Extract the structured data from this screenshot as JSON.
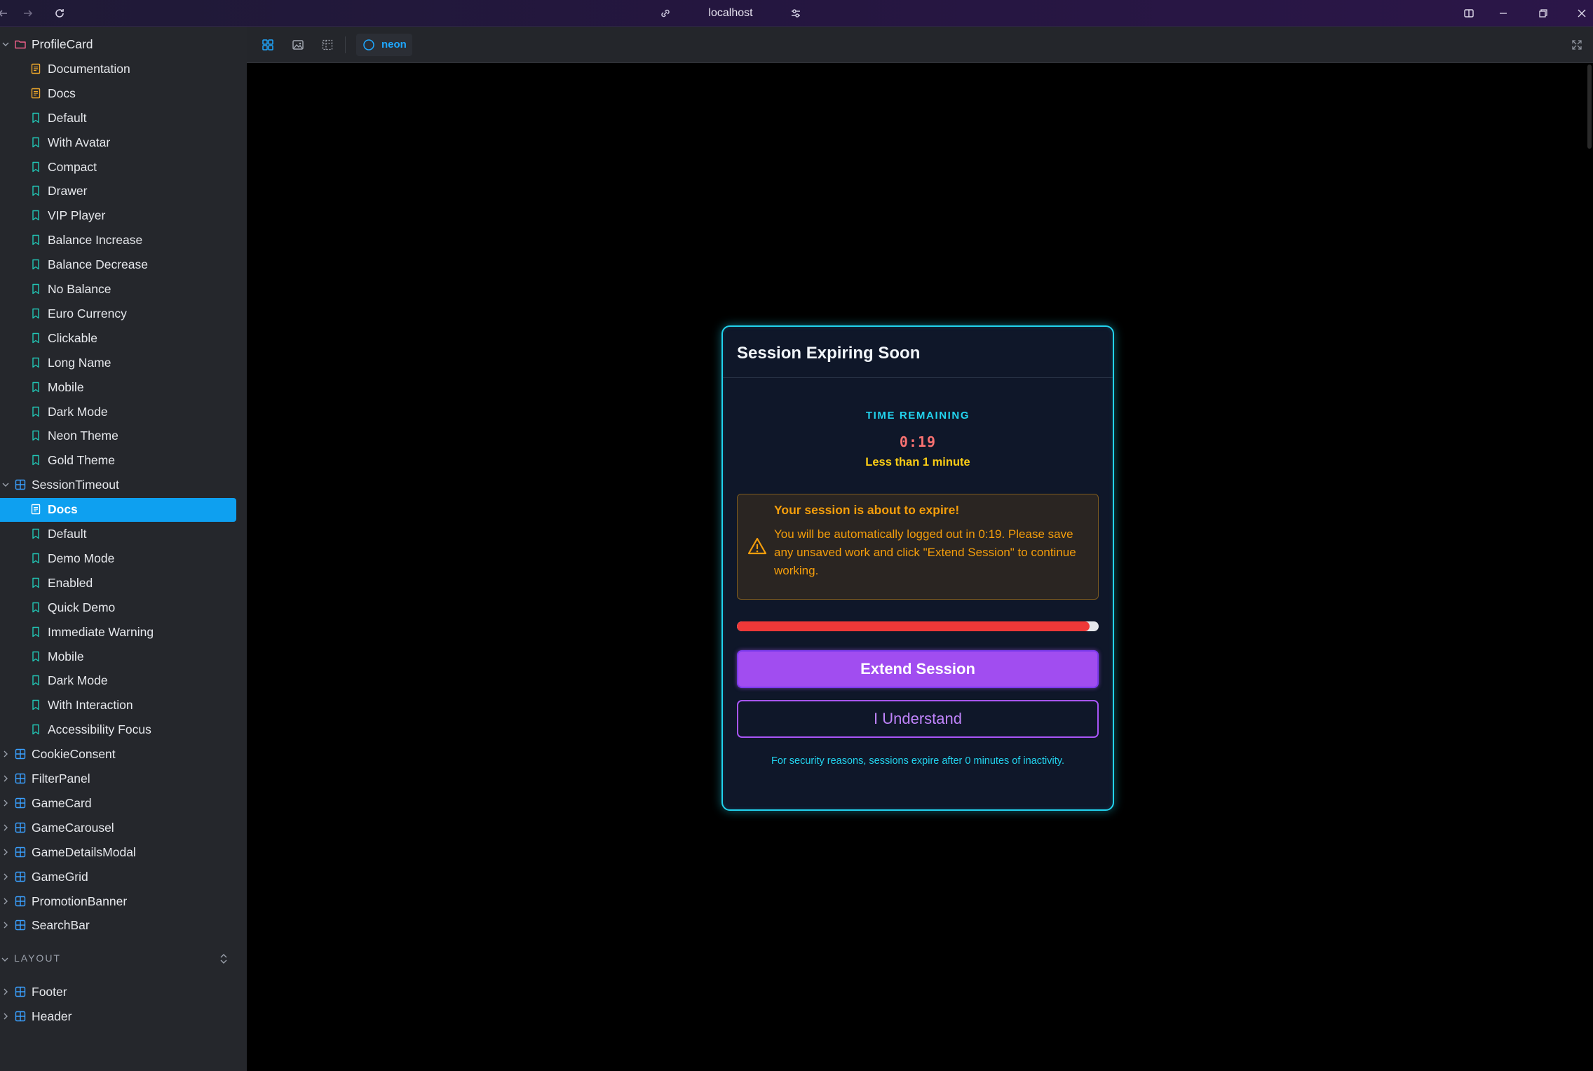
{
  "browser": {
    "url": "localhost",
    "icons": [
      "back-icon",
      "forward-icon",
      "reload-icon",
      "link-icon",
      "tune-icon",
      "split-view-icon",
      "minimize-icon",
      "restore-icon",
      "close-icon"
    ]
  },
  "sidebar": {
    "groups": [
      {
        "label": "ProfileCard",
        "icon": "folder-icon",
        "expanded": true,
        "children": [
          {
            "label": "Documentation",
            "kind": "docs"
          },
          {
            "label": "Docs",
            "kind": "docs"
          },
          {
            "label": "Default",
            "kind": "story"
          },
          {
            "label": "With Avatar",
            "kind": "story"
          },
          {
            "label": "Compact",
            "kind": "story"
          },
          {
            "label": "Drawer",
            "kind": "story"
          },
          {
            "label": "VIP Player",
            "kind": "story"
          },
          {
            "label": "Balance Increase",
            "kind": "story"
          },
          {
            "label": "Balance Decrease",
            "kind": "story"
          },
          {
            "label": "No Balance",
            "kind": "story"
          },
          {
            "label": "Euro Currency",
            "kind": "story"
          },
          {
            "label": "Clickable",
            "kind": "story"
          },
          {
            "label": "Long Name",
            "kind": "story"
          },
          {
            "label": "Mobile",
            "kind": "story"
          },
          {
            "label": "Dark Mode",
            "kind": "story"
          },
          {
            "label": "Neon Theme",
            "kind": "story"
          },
          {
            "label": "Gold Theme",
            "kind": "story"
          }
        ]
      },
      {
        "label": "SessionTimeout",
        "icon": "component-icon",
        "expanded": true,
        "children": [
          {
            "label": "Docs",
            "kind": "docs",
            "selected": true
          },
          {
            "label": "Default",
            "kind": "story"
          },
          {
            "label": "Demo Mode",
            "kind": "story"
          },
          {
            "label": "Enabled",
            "kind": "story"
          },
          {
            "label": "Quick Demo",
            "kind": "story"
          },
          {
            "label": "Immediate Warning",
            "kind": "story"
          },
          {
            "label": "Mobile",
            "kind": "story"
          },
          {
            "label": "Dark Mode",
            "kind": "story"
          },
          {
            "label": "With Interaction",
            "kind": "story"
          },
          {
            "label": "Accessibility Focus",
            "kind": "story"
          }
        ]
      }
    ],
    "collapsed_components": [
      "CookieConsent",
      "FilterPanel",
      "GameCard",
      "GameCarousel",
      "GameDetailsModal",
      "GameGrid",
      "PromotionBanner",
      "SearchBar"
    ],
    "layout_section": {
      "label": "LAYOUT",
      "items": [
        "Footer",
        "Header"
      ]
    }
  },
  "toolbar": {
    "theme_label": "neon",
    "icons": [
      "grid-icon",
      "image-icon",
      "frame-icon",
      "theme-circle-icon",
      "fullscreen-icon"
    ]
  },
  "modal": {
    "title": "Session Expiring Soon",
    "time_label": "TIME REMAINING",
    "time_value": "0:19",
    "time_sub": "Less than 1 minute",
    "warning_title": "Your session is about to expire!",
    "warning_text": "You will be automatically logged out in 0:19. Please save any unsaved work and click \"Extend Session\" to continue working.",
    "progress_fraction": 0.975,
    "primary_button": "Extend Session",
    "secondary_button": "I Understand",
    "footer_note": "For security reasons, sessions expire after 0 minutes of inactivity."
  },
  "colors": {
    "accent_blue": "#0ea0f0",
    "story_icon": "#22c5b4",
    "docs_icon": "#f0a92b",
    "folder_icon": "#f0608a",
    "component_icon": "#3aa0ff",
    "modal_border": "#22d3ee",
    "warning": "#f59e0b",
    "danger": "#ef3838",
    "primary_button": "#a14df0"
  }
}
